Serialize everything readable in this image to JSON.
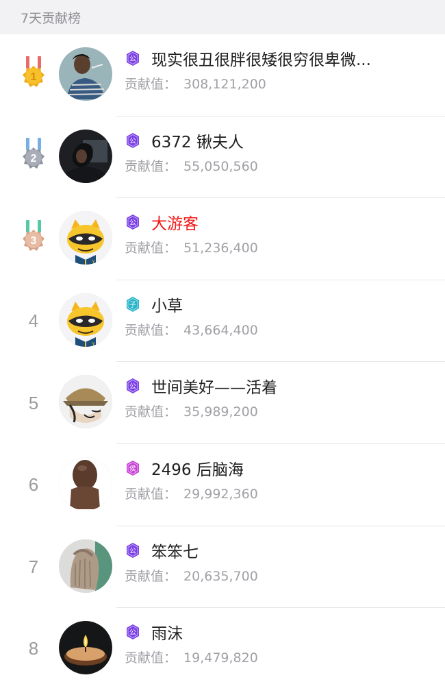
{
  "header": {
    "title": "7天贡献榜"
  },
  "score_label": "贡献值：",
  "entries": [
    {
      "rank": "1",
      "badge_text": "公",
      "badge_color": "#7a3ee6",
      "name": "现实很丑很胖很矮很穷很卑微...",
      "score": "308,121,200",
      "name_color": "#1f1f1f",
      "medal": "gold",
      "avatar_style": "photo-man"
    },
    {
      "rank": "2",
      "badge_text": "公",
      "badge_color": "#7a3ee6",
      "name": "6372 锹夫人",
      "score": "55,050,560",
      "name_color": "#1f1f1f",
      "medal": "silver",
      "avatar_style": "dark-portrait"
    },
    {
      "rank": "3",
      "badge_text": "公",
      "badge_color": "#7a3ee6",
      "name": "大游客",
      "score": "51,236,400",
      "name_color": "#f41818",
      "medal": "bronze",
      "avatar_style": "raccoon"
    },
    {
      "rank": "4",
      "badge_text": "子",
      "badge_color": "#25b3c8",
      "name": "小草",
      "score": "43,664,400",
      "name_color": "#1f1f1f",
      "medal": "",
      "avatar_style": "raccoon"
    },
    {
      "rank": "5",
      "badge_text": "公",
      "badge_color": "#7a3ee6",
      "name": "世间美好——活着",
      "score": "35,989,200",
      "name_color": "#1f1f1f",
      "medal": "",
      "avatar_style": "manga"
    },
    {
      "rank": "6",
      "badge_text": "侯",
      "badge_color": "#c83fd6",
      "name": "2496 后脑海",
      "score": "29,992,360",
      "name_color": "#1f1f1f",
      "medal": "",
      "avatar_style": "bald"
    },
    {
      "rank": "7",
      "badge_text": "公",
      "badge_color": "#7a3ee6",
      "name": "笨笨七",
      "score": "20,635,700",
      "name_color": "#1f1f1f",
      "medal": "",
      "avatar_style": "long-hair"
    },
    {
      "rank": "8",
      "badge_text": "公",
      "badge_color": "#7a3ee6",
      "name": "雨沫",
      "score": "19,479,820",
      "name_color": "#1f1f1f",
      "medal": "",
      "avatar_style": "candle"
    }
  ]
}
